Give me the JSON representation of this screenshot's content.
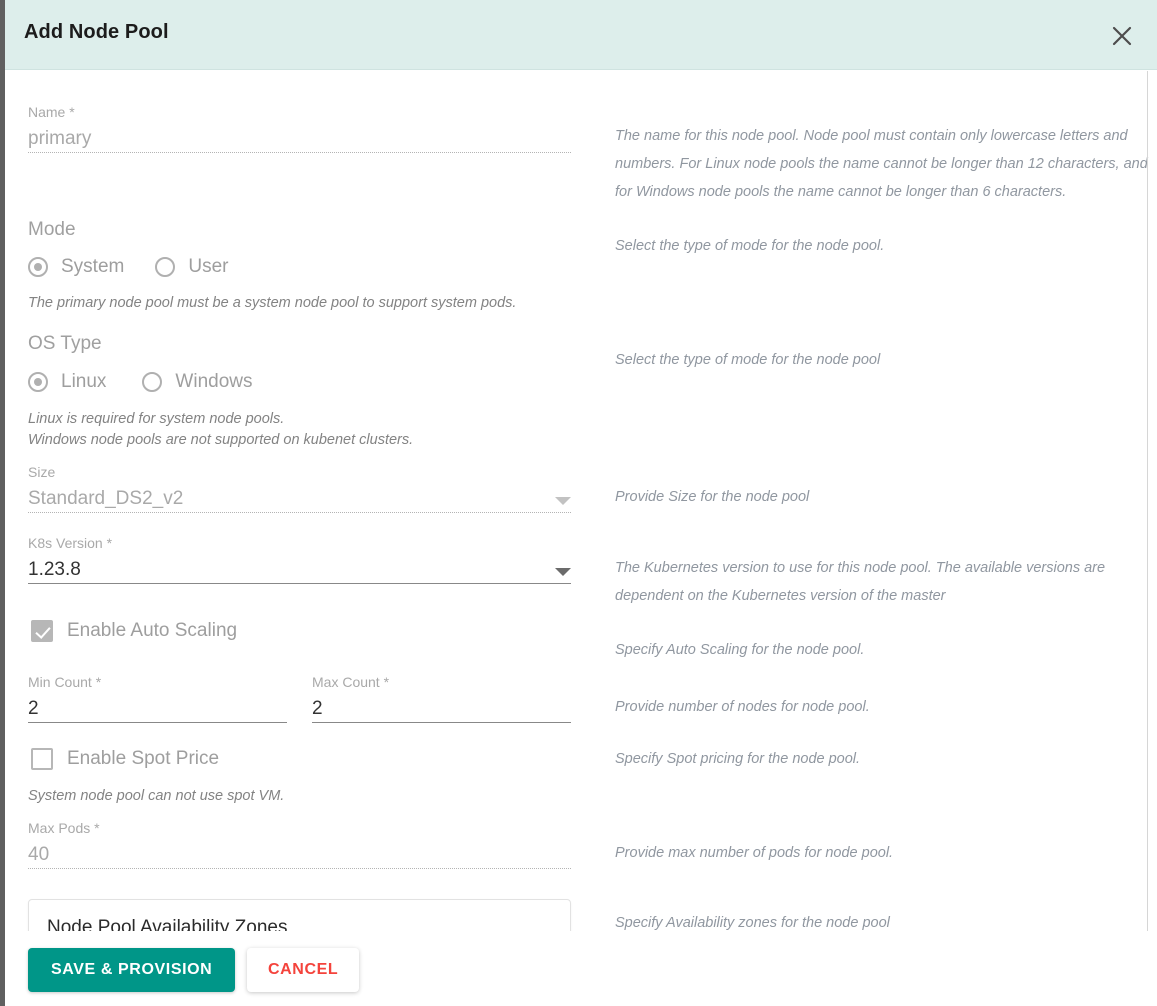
{
  "dialog": {
    "title": "Add Node Pool",
    "close_icon": "close-icon"
  },
  "form": {
    "name": {
      "label": "Name",
      "required": true,
      "value": "primary",
      "disabled": true,
      "help": "The name for this node pool. Node pool must contain only lowercase letters and numbers. For Linux node pools the name cannot be longer than 12 characters, and for Windows node pools the name cannot be longer than 6 characters."
    },
    "mode": {
      "label": "Mode",
      "options": [
        "System",
        "User"
      ],
      "selected": "System",
      "hint": "The primary node pool must be a system node pool to support system pods.",
      "help": "Select the type of mode for the node pool."
    },
    "os_type": {
      "label": "OS Type",
      "options": [
        "Linux",
        "Windows"
      ],
      "selected": "Linux",
      "hint_1": "Linux is required for system node pools.",
      "hint_2": "Windows node pools are not supported on kubenet clusters.",
      "help": "Select the type of mode for the node pool"
    },
    "size": {
      "label": "Size",
      "required": false,
      "value": "Standard_DS2_v2",
      "disabled": true,
      "dropdown_icon": "chevron-down-icon",
      "help": "Provide Size for the node pool"
    },
    "k8s_version": {
      "label": "K8s Version",
      "required": true,
      "value": "1.23.8",
      "disabled": false,
      "dropdown_icon": "chevron-down-icon",
      "help": "The Kubernetes version to use for this node pool. The available versions are dependent on the Kubernetes version of the master"
    },
    "enable_auto_scaling": {
      "label": "Enable Auto Scaling",
      "checked": true,
      "disabled": true,
      "help": "Specify Auto Scaling for the node pool."
    },
    "min_count": {
      "label": "Min Count",
      "required": true,
      "value": "2",
      "disabled": false
    },
    "max_count": {
      "label": "Max Count",
      "required": true,
      "value": "2",
      "disabled": false,
      "help": "Provide number of nodes for node pool."
    },
    "enable_spot_price": {
      "label": "Enable Spot Price",
      "checked": false,
      "disabled": true,
      "hint": "System node pool can not use spot VM.",
      "help": "Specify Spot pricing for the node pool."
    },
    "max_pods": {
      "label": "Max Pods",
      "required": true,
      "value": "40",
      "disabled": true,
      "help": "Provide max number of pods for node pool."
    },
    "availability_zones": {
      "title": "Node Pool Availability Zones",
      "help": "Specify Availability zones for the node pool"
    }
  },
  "footer": {
    "save_label": "SAVE & PROVISION",
    "cancel_label": "CANCEL"
  },
  "colors": {
    "header_bg": "#ddeeeb",
    "primary_button": "#009688",
    "cancel_text": "#f4433c",
    "backdrop": "#606060"
  }
}
